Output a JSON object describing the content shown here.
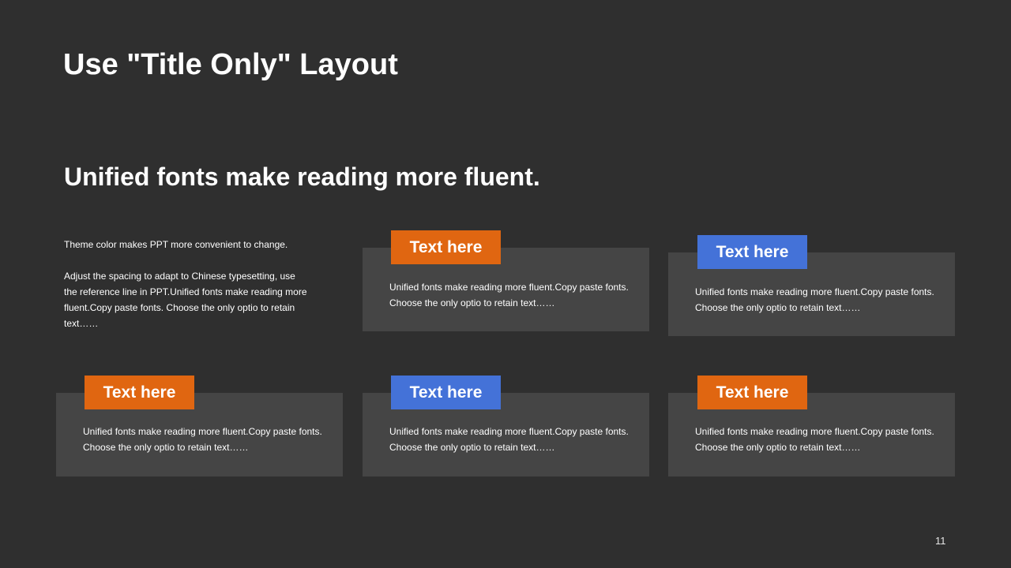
{
  "slide": {
    "title": "Use \"Title Only\" Layout",
    "subtitle": "Unified fonts make reading more fluent.",
    "intro": {
      "paragraph1": "Theme  color makes PPT more convenient to change.",
      "paragraph2": "Adjust the spacing to adapt to Chinese typesetting, use the reference line in PPT.Unified fonts make reading more fluent.Copy paste fonts. Choose the only optio to retain text……"
    },
    "cards": [
      {
        "tag": "Text here",
        "tag_color": "orange",
        "text": "Unified fonts make reading more fluent.Copy paste fonts. Choose the only optio to retain text……"
      },
      {
        "tag": "Text here",
        "tag_color": "blue",
        "text": "Unified fonts make reading more fluent.Copy paste fonts. Choose the only optio to retain text……"
      },
      {
        "tag": "Text here",
        "tag_color": "orange",
        "text": "Unified fonts make reading more fluent.Copy paste fonts. Choose the only optio to retain text……"
      },
      {
        "tag": "Text here",
        "tag_color": "blue",
        "text": "Unified fonts make reading more fluent.Copy paste fonts. Choose the only optio to retain text……"
      },
      {
        "tag": "Text here",
        "tag_color": "orange",
        "text": "Unified fonts make reading more fluent.Copy paste fonts. Choose the only optio to retain text……"
      }
    ],
    "page_number": "11"
  },
  "colors": {
    "background": "#2f2f2f",
    "card": "#454545",
    "accent_orange": "#e06611",
    "accent_blue": "#4472d8",
    "text": "#ffffff"
  }
}
